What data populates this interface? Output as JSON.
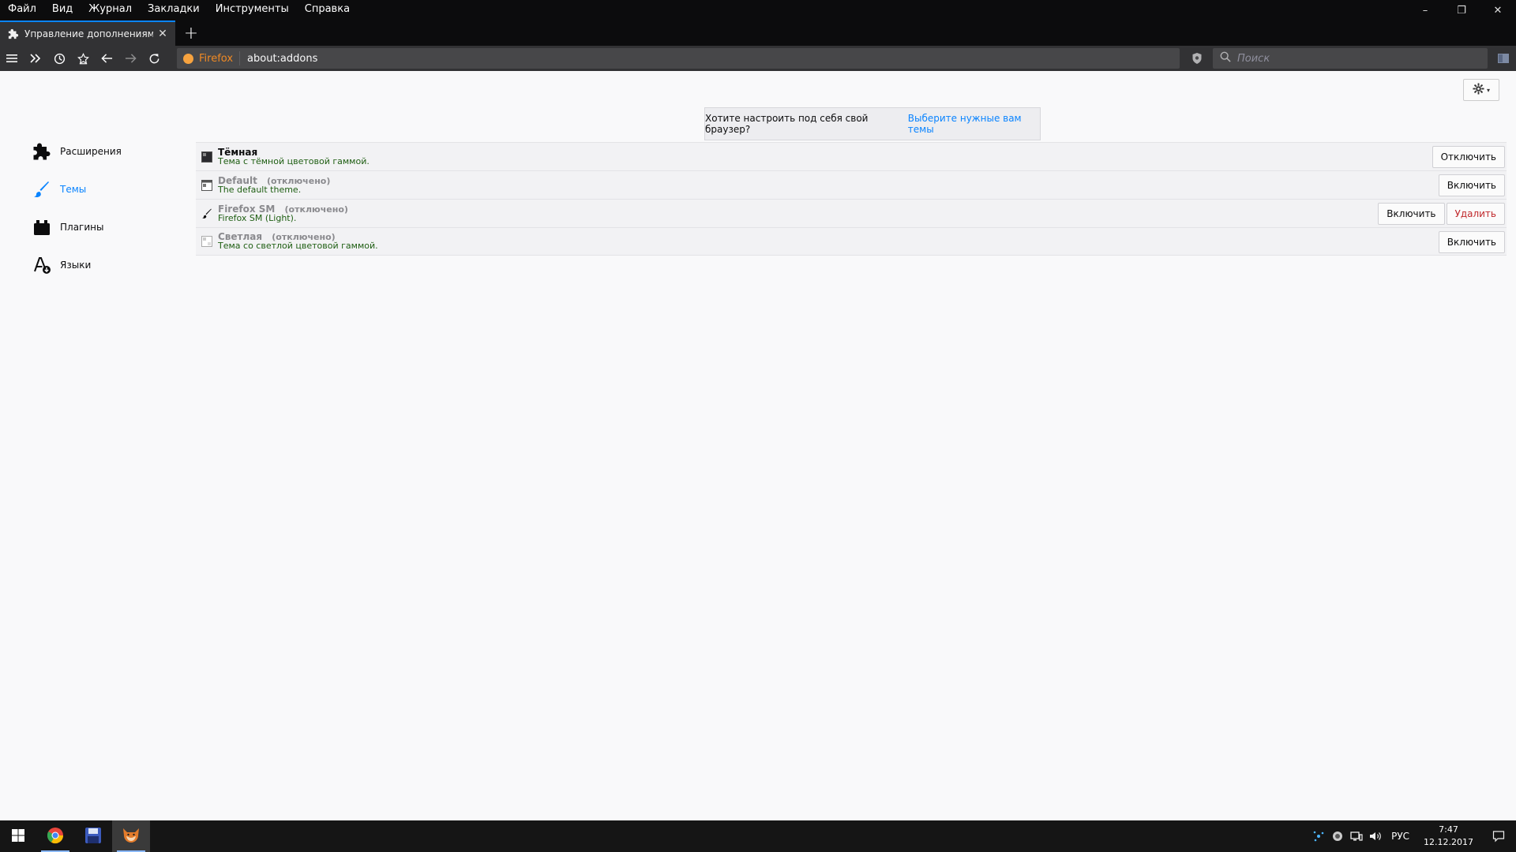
{
  "menubar": {
    "items": [
      "Файл",
      "Вид",
      "Журнал",
      "Закладки",
      "Инструменты",
      "Справка"
    ]
  },
  "window_controls": {
    "minimize": "–",
    "restore": "❐",
    "close": "✕"
  },
  "tab": {
    "title": "Управление дополнениями",
    "close": "✕"
  },
  "newtab": "+",
  "navbar": {
    "identity_label": "Firefox",
    "url": "about:addons",
    "search_placeholder": "Поиск"
  },
  "sidebar_categories": [
    {
      "label": "Расширения",
      "icon": "puzzle-icon"
    },
    {
      "label": "Темы",
      "icon": "brush-icon",
      "selected": true
    },
    {
      "label": "Плагины",
      "icon": "plugin-icon"
    },
    {
      "label": "Языки",
      "icon": "language-icon"
    }
  ],
  "notice": {
    "text": "Хотите настроить под себя свой браузер?",
    "link": "Выберите нужные вам темы"
  },
  "themes": [
    {
      "name": "Тёмная",
      "status": "",
      "description": "Тема с тёмной цветовой гаммой.",
      "buttons": [
        "Отключить"
      ]
    },
    {
      "name": "Default",
      "status": "(отключено)",
      "description": "The default theme.",
      "buttons": [
        "Включить"
      ]
    },
    {
      "name": "Firefox SM",
      "status": "(отключено)",
      "description": "Firefox SM (Light).",
      "buttons": [
        "Включить",
        "Удалить"
      ]
    },
    {
      "name": "Светлая",
      "status": "(отключено)",
      "description": "Тема со светлой цветовой гаммой.",
      "buttons": [
        "Включить"
      ]
    }
  ],
  "taskbar": {
    "lang": "РУС",
    "time": "7:47",
    "date": "12.12.2017"
  },
  "colors": {
    "accent": "#0a84ff",
    "chrome_dark": "#0c0c0d",
    "toolbar": "#323234",
    "description_green": "#1e5e12",
    "danger": "#c0282b"
  }
}
